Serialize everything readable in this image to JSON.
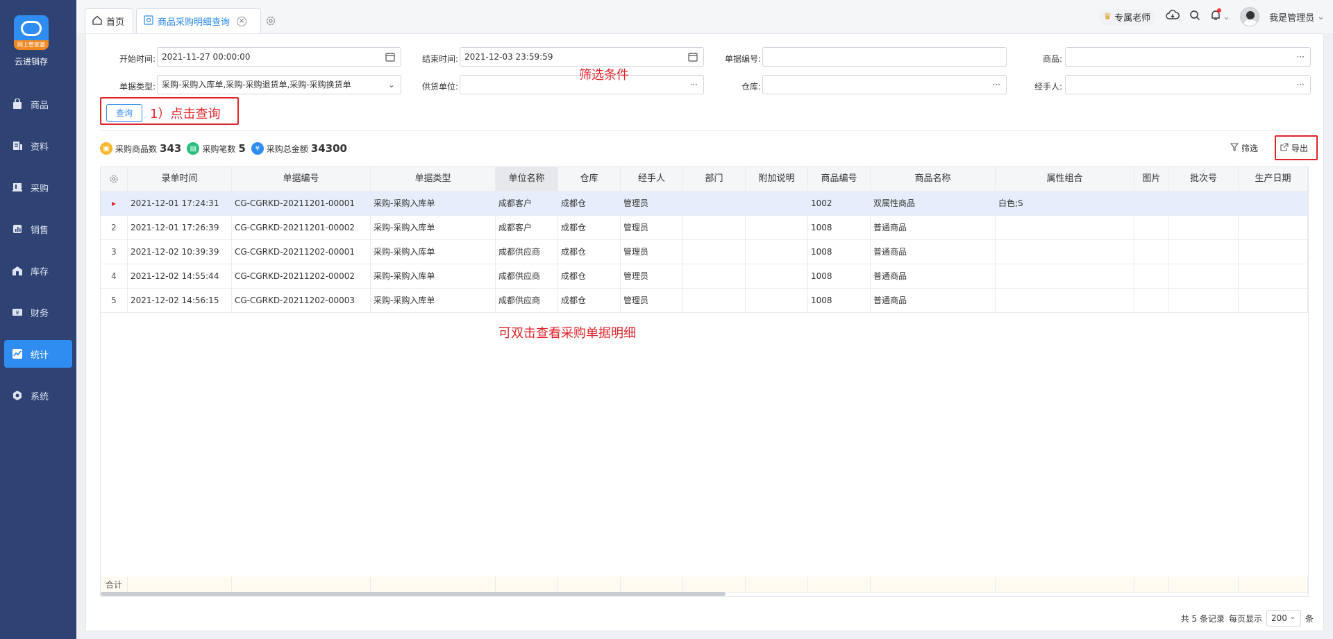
{
  "sidebar": {
    "brand": "云进销存",
    "logo_tag": "网上管家婆",
    "items": [
      {
        "label": "商品",
        "icon": "bag-icon"
      },
      {
        "label": "资料",
        "icon": "doc-icon"
      },
      {
        "label": "采购",
        "icon": "cart-icon"
      },
      {
        "label": "销售",
        "icon": "chart-icon"
      },
      {
        "label": "库存",
        "icon": "warehouse-icon"
      },
      {
        "label": "财务",
        "icon": "money-icon"
      },
      {
        "label": "统计",
        "icon": "trend-icon"
      },
      {
        "label": "系统",
        "icon": "hex-icon"
      }
    ],
    "active": "统计"
  },
  "tabs": {
    "home": "首页",
    "current": "商品采购明细查询",
    "close": "×"
  },
  "header": {
    "vip": "专属老师",
    "user": "我是管理员"
  },
  "filters": {
    "start_label": "开始时间:",
    "start_value": "2021-11-27 00:00:00",
    "end_label": "结束时间:",
    "end_value": "2021-12-03 23:59:59",
    "docno_label": "单据编号:",
    "goods_label": "商品:",
    "doctype_label": "单据类型:",
    "doctype_value": "采购-采购入库单,采购-采购退货单,采购-采购换货单",
    "supplier_label": "供货单位:",
    "store_label": "仓库:",
    "handler_label": "经手人:",
    "more": "···",
    "query_button": "查询"
  },
  "annotations": {
    "filter_hint": "筛选条件",
    "click_query": "1）点击查询",
    "dblclick_hint": "可双击查看采购单据明细"
  },
  "stats": {
    "qty_label": "采购商品数",
    "qty_value": "343",
    "count_label": "采购笔数",
    "count_value": "5",
    "amount_label": "采购总金额",
    "amount_value": "34300"
  },
  "toolbar": {
    "filter_label": "筛选",
    "export_label": "导出"
  },
  "table": {
    "columns": [
      "录单时间",
      "单据编号",
      "单据类型",
      "单位名称",
      "仓库",
      "经手人",
      "部门",
      "附加说明",
      "商品编号",
      "商品名称",
      "属性组合",
      "图片",
      "批次号",
      "生产日期"
    ],
    "rows": [
      {
        "idx": "▸",
        "time": "2021-12-01 17:24:31",
        "no": "CG-CGRKD-20211201-00001",
        "type": "采购-采购入库单",
        "unit": "成都客户",
        "store": "成都仓",
        "handler": "管理员",
        "goods_no": "1002",
        "goods_name": "双属性商品",
        "attr": "白色;S"
      },
      {
        "idx": "2",
        "time": "2021-12-01 17:26:39",
        "no": "CG-CGRKD-20211201-00002",
        "type": "采购-采购入库单",
        "unit": "成都客户",
        "store": "成都仓",
        "handler": "管理员",
        "goods_no": "1008",
        "goods_name": "普通商品",
        "attr": ""
      },
      {
        "idx": "3",
        "time": "2021-12-02 10:39:39",
        "no": "CG-CGRKD-20211202-00001",
        "type": "采购-采购入库单",
        "unit": "成都供应商",
        "store": "成都仓",
        "handler": "管理员",
        "goods_no": "1008",
        "goods_name": "普通商品",
        "attr": ""
      },
      {
        "idx": "4",
        "time": "2021-12-02 14:55:44",
        "no": "CG-CGRKD-20211202-00002",
        "type": "采购-采购入库单",
        "unit": "成都供应商",
        "store": "成都仓",
        "handler": "管理员",
        "goods_no": "1008",
        "goods_name": "普通商品",
        "attr": ""
      },
      {
        "idx": "5",
        "time": "2021-12-02 14:56:15",
        "no": "CG-CGRKD-20211202-00003",
        "type": "采购-采购入库单",
        "unit": "成都供应商",
        "store": "成都仓",
        "handler": "管理员",
        "goods_no": "1008",
        "goods_name": "普通商品",
        "attr": ""
      }
    ],
    "sum_label": "合计"
  },
  "pager": {
    "total": "共 5 条记录",
    "per_page_label": "每页显示",
    "per_page": "200",
    "unit": "条"
  },
  "colors": {
    "sidebar": "#2e4374",
    "accent": "#2f8cf0",
    "annotation": "#e0242a"
  }
}
